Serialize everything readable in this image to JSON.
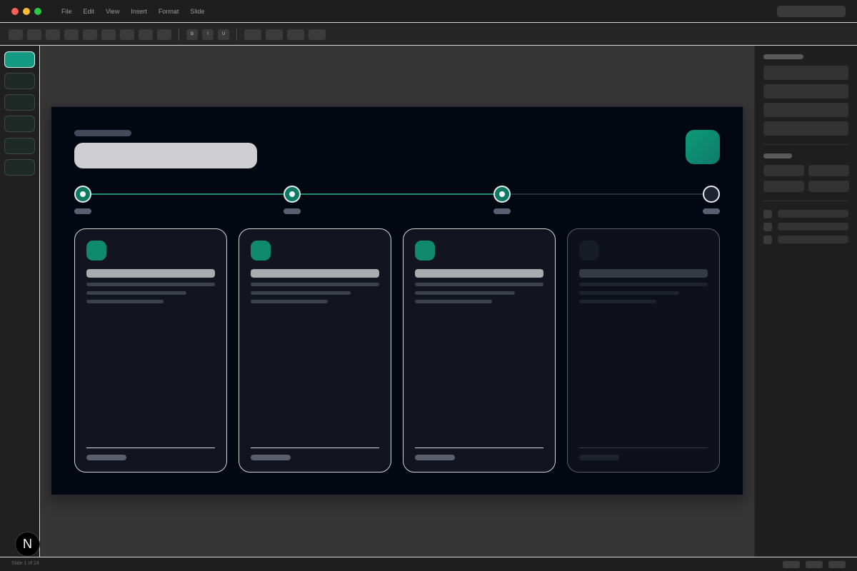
{
  "window": {
    "menu": [
      "File",
      "Edit",
      "View",
      "Insert",
      "Format",
      "Slide"
    ]
  },
  "toolbar": {
    "bold_label": "B",
    "italic_label": "I",
    "underline_label": "U"
  },
  "thumbnails": {
    "active_index": 0,
    "count_visible": 6
  },
  "slide": {
    "steps": [
      {
        "state": "complete"
      },
      {
        "state": "complete"
      },
      {
        "state": "complete"
      },
      {
        "state": "pending"
      }
    ],
    "cards": [
      {
        "state": "active"
      },
      {
        "state": "active"
      },
      {
        "state": "active"
      },
      {
        "state": "dimmed"
      }
    ]
  },
  "colors": {
    "accent": "#0f8a6c",
    "slide_bg": "#030711",
    "card_bg": "#121520"
  },
  "status": {
    "slide_counter": "Slide 1 of 24"
  },
  "badge": {
    "letter": "N"
  }
}
